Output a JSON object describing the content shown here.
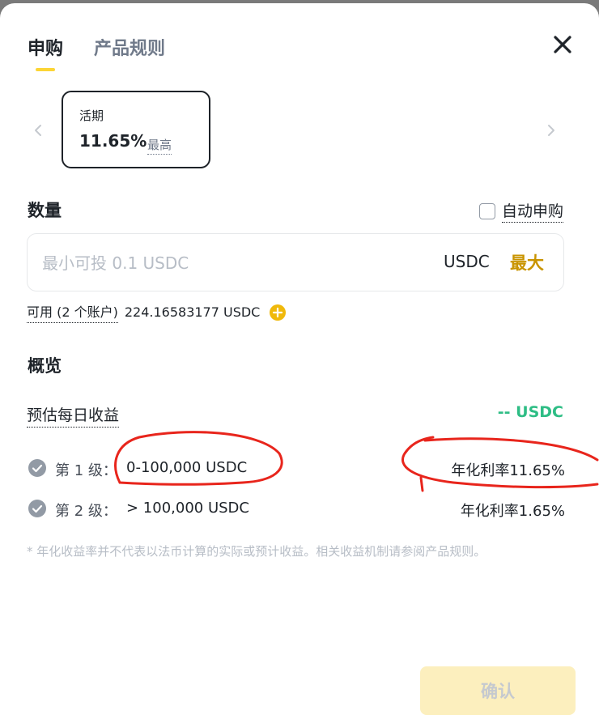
{
  "tabs": [
    {
      "label": "申购",
      "active": true
    },
    {
      "label": "产品规则",
      "active": false
    }
  ],
  "product": {
    "name": "活期",
    "rate": "11.65%",
    "rate_tag": "最高"
  },
  "quantity": {
    "title": "数量",
    "auto_subscribe_label": "自动申购",
    "auto_subscribe_checked": false,
    "input_value": "",
    "input_placeholder": "最小可投 0.1 USDC",
    "currency": "USDC",
    "max_label": "最大",
    "available_label": "可用 (2 个账户)",
    "available_value": "224.16583177 USDC"
  },
  "overview": {
    "title": "概览",
    "est_daily_label": "预估每日收益",
    "est_daily_value": "-- USDC",
    "tiers": [
      {
        "label": "第 1 级：",
        "range": "0-100,000 USDC",
        "rate": "年化利率11.65%"
      },
      {
        "label": "第 2 级：",
        "range": "> 100,000 USDC",
        "rate": "年化利率1.65%"
      }
    ],
    "disclaimer": "* 年化收益率并不代表以法币计算的实际或预计收益。相关收益机制请参阅产品规则。"
  },
  "confirm_label": "确认",
  "colors": {
    "accent_yellow": "#fcd535",
    "max_gold": "#c99400",
    "positive_green": "#2ebd85",
    "annotation_red": "#e8251c",
    "confirm_disabled_bg": "#fcefbe"
  }
}
